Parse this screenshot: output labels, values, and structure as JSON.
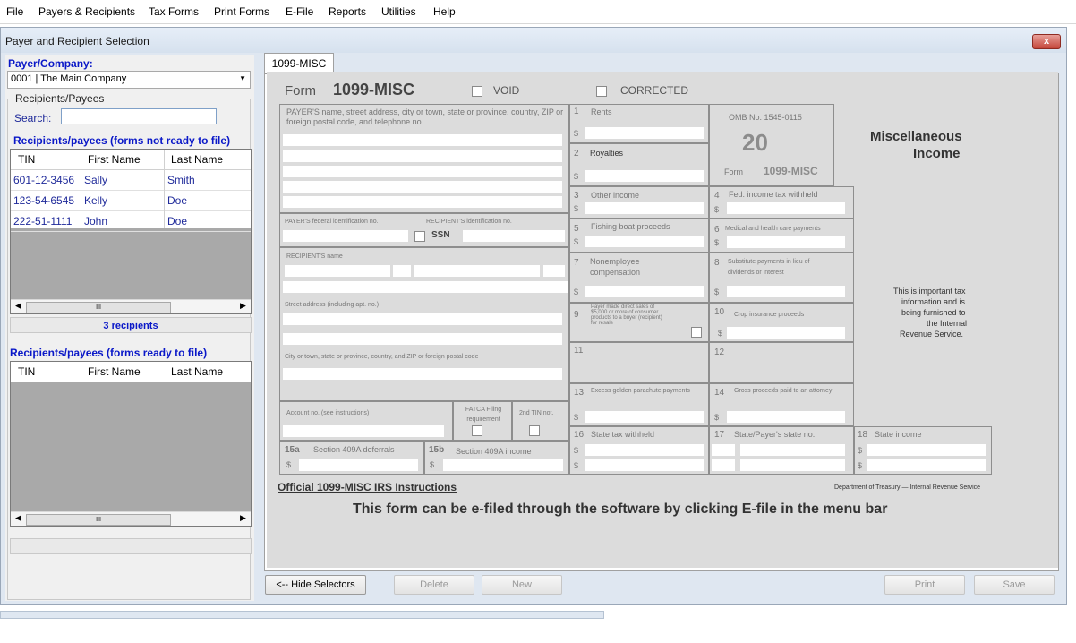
{
  "menu": [
    "File",
    "Payers & Recipients",
    "Tax Forms",
    "Print Forms",
    "E-File",
    "Reports",
    "Utilities",
    "Help"
  ],
  "window": {
    "title": "Payer and Recipient Selection",
    "close": "x"
  },
  "payer": {
    "label": "Payer/Company:",
    "selected": "0001 | The Main Company"
  },
  "recipients_group": {
    "label": "Recipients/Payees",
    "search_label": "Search:",
    "search_value": ""
  },
  "not_ready": {
    "title": "Recipients/payees (forms not ready to file)",
    "columns": [
      "TIN",
      "First Name",
      "Last Name"
    ],
    "rows": [
      [
        "601-12-3456",
        "Sally",
        "Smith"
      ],
      [
        "123-54-6545",
        "Kelly",
        "Doe"
      ],
      [
        "222-51-1111",
        "John",
        "Doe"
      ]
    ],
    "count": "3 recipients"
  },
  "ready": {
    "title": "Recipients/payees (forms ready to file)",
    "columns": [
      "TIN",
      "First Name",
      "Last Name"
    ]
  },
  "tab": "1099-MISC",
  "form": {
    "form_word": "Form",
    "form_name": "1099-MISC",
    "void": "VOID",
    "corrected": "CORRECTED",
    "payer_name_label": "PAYER'S name, street address, city or town, state or province, country, ZIP or foreign postal code, and telephone no.",
    "payer_fed_id": "PAYER'S federal identification no.",
    "recipient_id": "RECIPIENT'S identification no.",
    "ssn": "SSN",
    "recipient_name": "RECIPIENT'S name",
    "street": "Street address (including apt. no.)",
    "city": "City or town, state or province, country, and ZIP or foreign postal code",
    "account": "Account no. (see instructions)",
    "fatca": "FATCA Filing requirement",
    "tin2": "2nd TIN not.",
    "b15a_num": "15a",
    "b15a": "Section 409A deferrals",
    "b15b_num": "15b",
    "b15b": "Section 409A income",
    "b1": "Rents",
    "b2": "Royalties",
    "b3": "Other income",
    "b4": "Fed. income tax withheld",
    "b5": "Fishing boat proceeds",
    "b6": "Medical and health care payments",
    "b7a": "Nonemployee",
    "b7b": "compensation",
    "b8a": "Substitute payments in lieu of",
    "b8b": "dividends or interest",
    "b9a": "Payer made direct sales of",
    "b9b": "$5,000 or more of consumer",
    "b9c": "products to a buyer  (recipient)",
    "b9d": "for resale",
    "b10": "Crop insurance proceeds",
    "b13": "Excess golden parachute payments",
    "b14": "Gross proceeds paid to an attorney",
    "b16": "State tax withheld",
    "b17": "State/Payer's state no.",
    "b18": "State income",
    "omb": "OMB No. 1545-0115",
    "year": "20",
    "form_small": "Form",
    "form_small_name": "1099-MISC",
    "title1": "Miscellaneous",
    "title2": "Income",
    "note1": "This is important tax",
    "note2": "information and is",
    "note3": "being furnished to",
    "note4": "the Internal",
    "note5": "Revenue Service.",
    "dept": "Department of Treasury — Internal Revenue Service",
    "link": "Official 1099-MISC IRS Instructions",
    "efile": "This form can be e-filed through the software by clicking E-file in the menu bar",
    "dollar": "$"
  },
  "buttons": {
    "hide": "<-- Hide Selectors",
    "delete": "Delete",
    "new": "New",
    "print": "Print",
    "save": "Save"
  },
  "scroll": {
    "grip": "III"
  }
}
